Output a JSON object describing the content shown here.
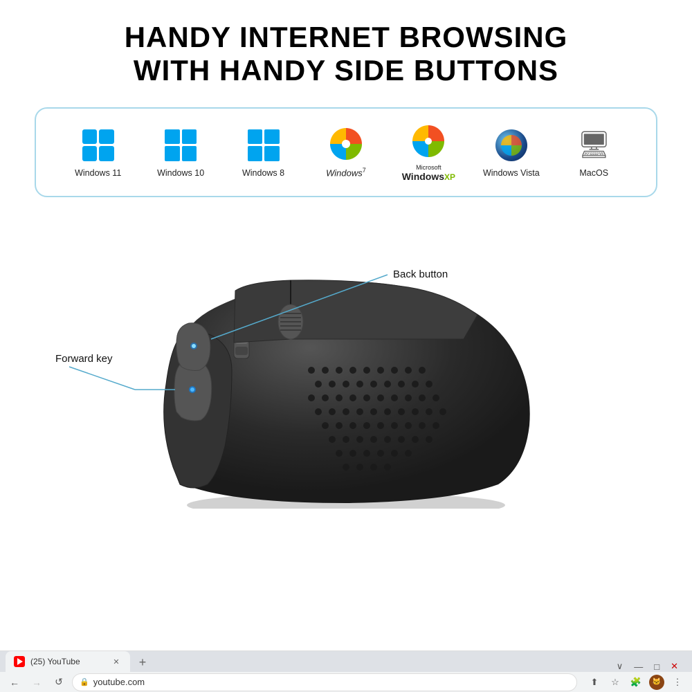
{
  "headline": {
    "line1": "HANDY INTERNET BROWSING",
    "line2": "WITH HANDY SIDE BUTTONS"
  },
  "os_items": [
    {
      "id": "win11",
      "label": "Windows 11",
      "type": "win-squares"
    },
    {
      "id": "win10",
      "label": "Windows 10",
      "type": "win-squares"
    },
    {
      "id": "win8",
      "label": "Windows 8",
      "type": "win-squares"
    },
    {
      "id": "win7",
      "label": "Windows 7",
      "type": "win-flag"
    },
    {
      "id": "winxp",
      "label": "Windows XP",
      "type": "win-xp"
    },
    {
      "id": "winvista",
      "label": "Windows Vista",
      "type": "win-vista"
    },
    {
      "id": "macos",
      "label": "MacOS",
      "type": "macos"
    }
  ],
  "mouse_labels": {
    "back_button": "Back button",
    "forward_key": "Forward key"
  },
  "browser": {
    "tab_title": "(25) YouTube",
    "tab_badge": "25",
    "new_tab_label": "+",
    "address": "youtube.com",
    "nav_buttons": [
      "←",
      "→",
      "↺"
    ],
    "win_controls": [
      "∨",
      "—",
      "□",
      "✕"
    ]
  }
}
